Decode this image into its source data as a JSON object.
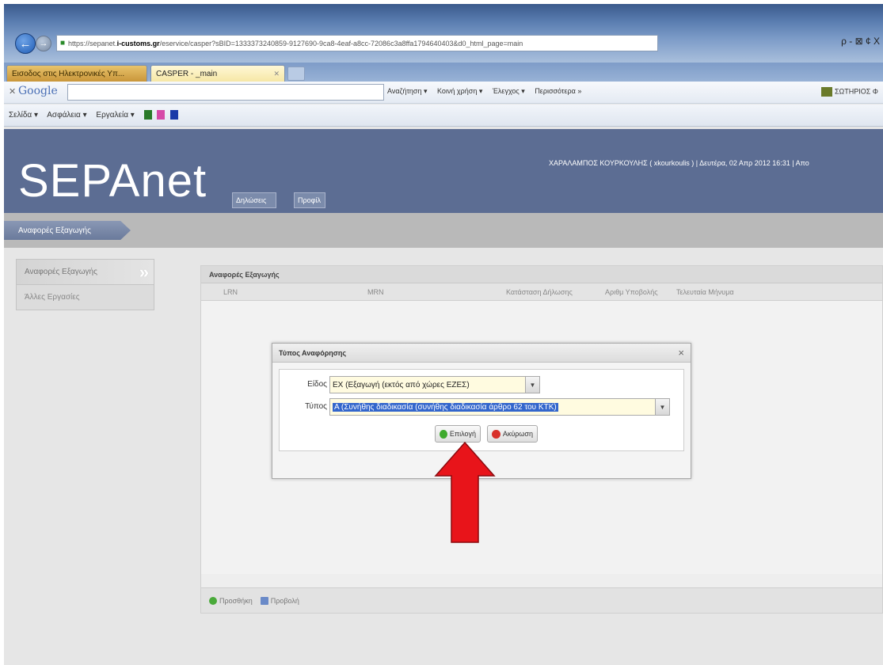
{
  "browser": {
    "url_prefix": "https://sepanet.",
    "url_domain": "i-customs.gr",
    "url_rest": "/eservice/casper?sBID=1333373240859-9127690-9ca8-4eaf-a8cc-72086c3a8ffa1794640403&d0_html_page=main",
    "addr_tools": "ρ - ⊠ ¢ X",
    "tabs": [
      {
        "label": "Εισοδος στις Ηλεκτρονικές Υπ..."
      },
      {
        "label": "CASPER - _main"
      }
    ],
    "google": {
      "logo": "Google",
      "items": [
        "Αναζήτηση ▾",
        "Κοινή χρήση ▾",
        "Έλεγχος ▾",
        "Περισσότερα »"
      ],
      "user": "ΣΩΤΗΡΙΟΣ Φ"
    },
    "cmdbar": {
      "items": [
        "Σελίδα ▾",
        "Ασφάλεια ▾",
        "Εργαλεία ▾"
      ]
    }
  },
  "app": {
    "logo": "SEPAnet",
    "header_tabs": [
      "Δηλώσεις",
      "Προφίλ"
    ],
    "user_info": "ΧΑΡΑΛΑΜΠΟΣ ΚΟΥΡΚΟΥΛΗΣ ( xkourkoulis ) | Δευτέρα, 02 Απρ 2012 16:31 | Απο",
    "breadcrumb": "Αναφορές Εξαγωγής",
    "sidebar": [
      {
        "label": "Αναφορές Εξαγωγής"
      },
      {
        "label": "Άλλες Εργασίες"
      }
    ],
    "panel": {
      "title": "Αναφορές Εξαγωγής",
      "columns": [
        "LRN",
        "MRN",
        "Κατάσταση Δήλωσης",
        "Αριθμ Υποβολής",
        "Τελευταία Μήνυμα"
      ],
      "footer": {
        "add": "Προσθήκη",
        "view": "Προβολή"
      }
    },
    "dialog": {
      "title": "Τύπος Αναφόρησης",
      "close": "×",
      "fields": {
        "kind_label": "Είδος",
        "kind_value": "EX (Εξαγωγή (εκτός από χώρες ΕΖΕΣ)",
        "type_label": "Τύπος",
        "type_value": "A (Συνήθης διαδικασία (συνήθης διαδικασία άρθρο 62 του ΚΤΚ)"
      },
      "buttons": {
        "ok": "Επιλογή",
        "cancel": "Ακύρωση"
      }
    }
  },
  "colors": {
    "header_bg": "#5c6d93",
    "arrow": "#e8141a",
    "selection": "#3366cc"
  }
}
